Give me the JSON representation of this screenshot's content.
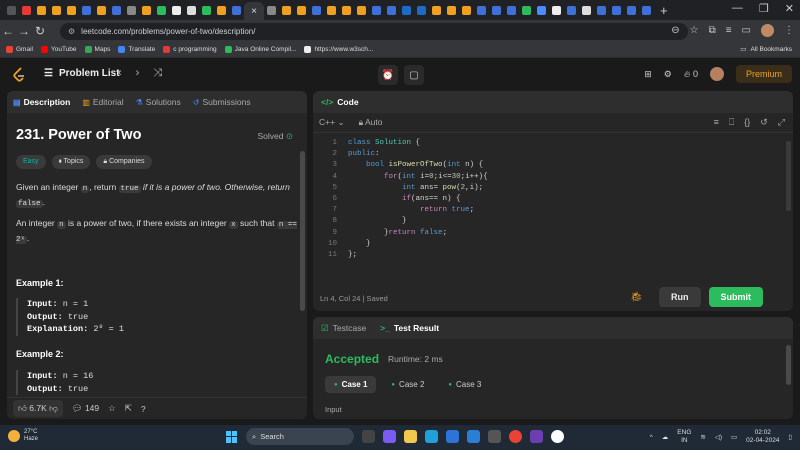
{
  "browser": {
    "tab_close": "×",
    "new_tab": "+",
    "url": "leetcode.com/problems/power-of-two/description/",
    "bookmarks": [
      "Gmail",
      "YouTube",
      "Maps",
      "Translate",
      "c programming",
      "Java Online Compil...",
      "https://www.w3sch..."
    ],
    "all_bookmarks": "All Bookmarks"
  },
  "lc_nav": {
    "problem_list": "Problem List",
    "streak_count": "0",
    "premium": "Premium"
  },
  "left": {
    "tabs": [
      "Description",
      "Editorial",
      "Solutions",
      "Submissions"
    ],
    "title": "231. Power of Two",
    "solved": "Solved",
    "chips": [
      "Easy",
      "Topics",
      "Companies"
    ],
    "p1_a": "Given an integer ",
    "p1_n": "n",
    "p1_b": ", return ",
    "p1_true": "true",
    "p1_c": " if it is a power of two. Otherwise, return ",
    "p1_false": "false",
    "p1_d": ".",
    "p2_a": "An integer ",
    "p2_n": "n",
    "p2_b": " is a power of two, if there exists an integer ",
    "p2_x": "x",
    "p2_c": " such that ",
    "p2_eq": "n == 2ˣ",
    "p2_d": ".",
    "ex1_title": "Example 1:",
    "ex1_input_label": "Input:",
    "ex1_input": " n = 1",
    "ex1_output_label": "Output:",
    "ex1_output": " true",
    "ex1_expl_label": "Explanation:",
    "ex1_expl": " 2⁰ = 1",
    "ex2_title": "Example 2:",
    "ex2_input_label": "Input:",
    "ex2_input": " n = 16",
    "ex2_output_label": "Output:",
    "ex2_output": " true",
    "likes": "6.7K",
    "comments": "149"
  },
  "code": {
    "header": "Code",
    "language": "C++",
    "mode": "Auto",
    "status": "Ln 4, Col 24  |  Saved",
    "run": "Run",
    "submit": "Submit",
    "lines": [
      "class Solution {",
      "public:",
      "    bool isPowerOfTwo(int n) {",
      "        for(int i=0;i<=30;i++){",
      "            int ans= pow(2,i);",
      "            if(ans== n) {",
      "                return true;",
      "            }",
      "        }return false;",
      "    }",
      "};"
    ]
  },
  "test": {
    "tabs": [
      "Testcase",
      "Test Result"
    ],
    "verdict": "Accepted",
    "runtime": "Runtime: 2 ms",
    "cases": [
      "Case 1",
      "Case 2",
      "Case 3"
    ],
    "input_label": "Input"
  },
  "taskbar": {
    "temp": "27°C",
    "condition": "Haze",
    "search": "Search",
    "lang1": "ENG",
    "lang2": "IN",
    "time": "02:02",
    "date": "02-04-2024"
  },
  "colors": {
    "accent_green": "#2cbb5d",
    "easy": "#00b8a3",
    "premium": "#f0a020"
  }
}
